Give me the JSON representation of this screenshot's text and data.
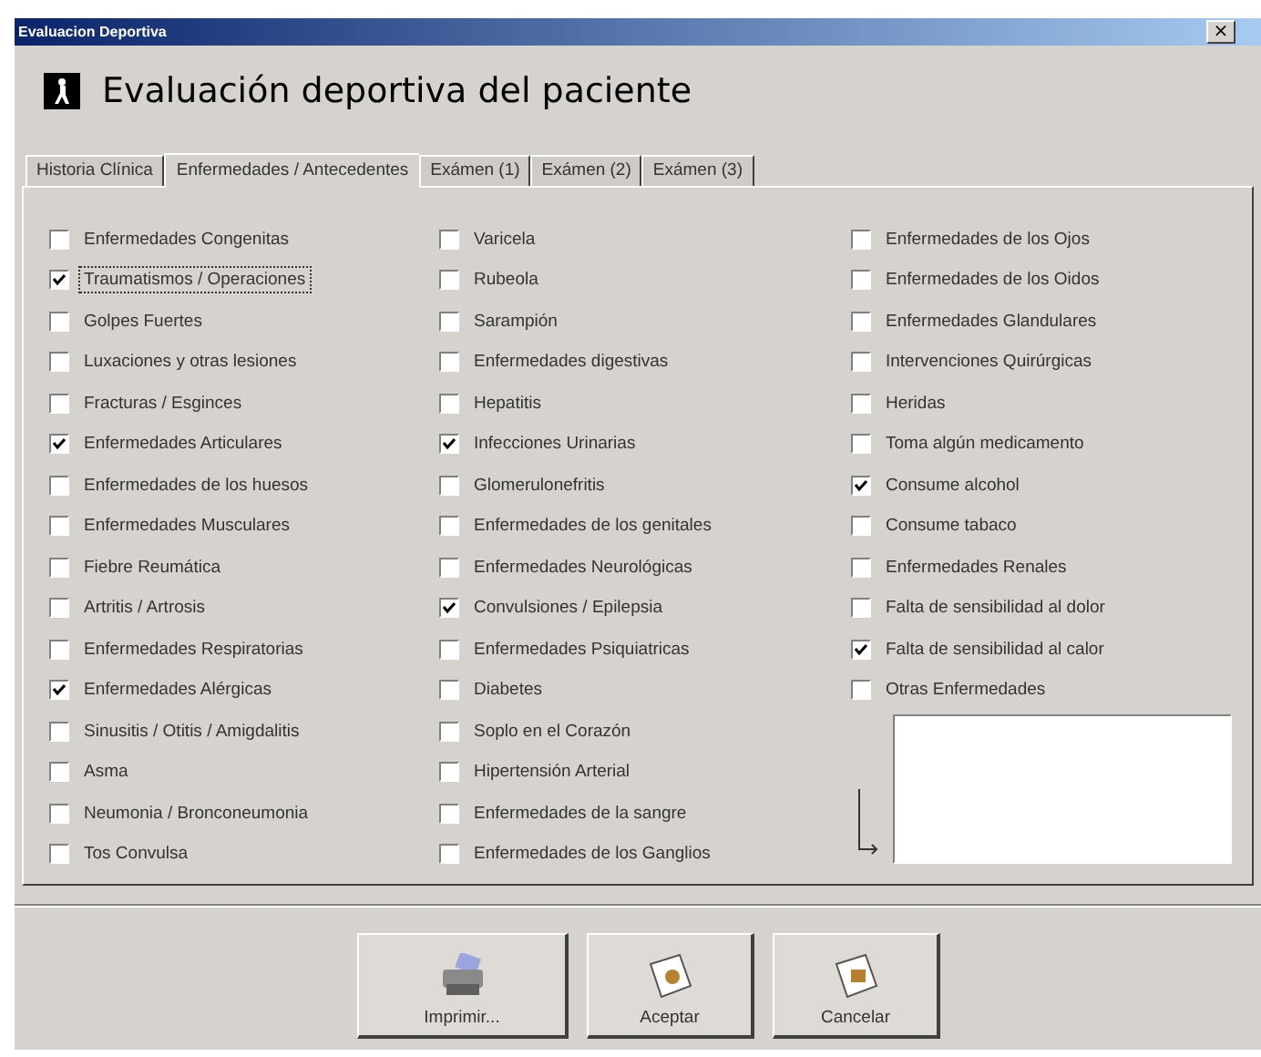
{
  "window": {
    "title": "Evaluacion Deportiva",
    "close": "×"
  },
  "header": {
    "title": "Evaluación deportiva del paciente"
  },
  "tabs": [
    {
      "label": "Historia Clínica",
      "selected": false
    },
    {
      "label": "Enfermedades / Antecedentes",
      "selected": true
    },
    {
      "label": "Exámen (1)",
      "selected": false
    },
    {
      "label": "Exámen (2)",
      "selected": false
    },
    {
      "label": "Exámen (3)",
      "selected": false
    }
  ],
  "columns": [
    {
      "items": [
        {
          "label": "Enfermedades Congenitas",
          "checked": false,
          "focused": false
        },
        {
          "label": "Traumatismos / Operaciones",
          "checked": true,
          "focused": true
        },
        {
          "label": "Golpes Fuertes",
          "checked": false,
          "focused": false
        },
        {
          "label": "Luxaciones y otras lesiones",
          "checked": false,
          "focused": false
        },
        {
          "label": "Fracturas / Esginces",
          "checked": false,
          "focused": false
        },
        {
          "label": "Enfermedades Articulares",
          "checked": true,
          "focused": false
        },
        {
          "label": "Enfermedades de los huesos",
          "checked": false,
          "focused": false
        },
        {
          "label": "Enfermedades Musculares",
          "checked": false,
          "focused": false
        },
        {
          "label": "Fiebre Reumática",
          "checked": false,
          "focused": false
        },
        {
          "label": "Artritis / Artrosis",
          "checked": false,
          "focused": false
        },
        {
          "label": "Enfermedades Respiratorias",
          "checked": false,
          "focused": false
        },
        {
          "label": "Enfermedades Alérgicas",
          "checked": true,
          "focused": false
        },
        {
          "label": "Sinusitis / Otitis / Amigdalitis",
          "checked": false,
          "focused": false
        },
        {
          "label": "Asma",
          "checked": false,
          "focused": false
        },
        {
          "label": "Neumonia / Bronconeumonia",
          "checked": false,
          "focused": false
        },
        {
          "label": "Tos Convulsa",
          "checked": false,
          "focused": false
        }
      ]
    },
    {
      "items": [
        {
          "label": "Varicela",
          "checked": false,
          "focused": false
        },
        {
          "label": "Rubeola",
          "checked": false,
          "focused": false
        },
        {
          "label": "Sarampión",
          "checked": false,
          "focused": false
        },
        {
          "label": "Enfermedades digestivas",
          "checked": false,
          "focused": false
        },
        {
          "label": "Hepatitis",
          "checked": false,
          "focused": false
        },
        {
          "label": "Infecciones Urinarias",
          "checked": true,
          "focused": false
        },
        {
          "label": "Glomerulonefritis",
          "checked": false,
          "focused": false
        },
        {
          "label": "Enfermedades de los genitales",
          "checked": false,
          "focused": false
        },
        {
          "label": "Enfermedades Neurológicas",
          "checked": false,
          "focused": false
        },
        {
          "label": "Convulsiones / Epilepsia",
          "checked": true,
          "focused": false
        },
        {
          "label": "Enfermedades Psiquiatricas",
          "checked": false,
          "focused": false
        },
        {
          "label": "Diabetes",
          "checked": false,
          "focused": false
        },
        {
          "label": "Soplo en el Corazón",
          "checked": false,
          "focused": false
        },
        {
          "label": "Hipertensión Arterial",
          "checked": false,
          "focused": false
        },
        {
          "label": "Enfermedades de la sangre",
          "checked": false,
          "focused": false
        },
        {
          "label": "Enfermedades de los Ganglios",
          "checked": false,
          "focused": false
        }
      ]
    },
    {
      "items": [
        {
          "label": "Enfermedades de los Ojos",
          "checked": false,
          "focused": false
        },
        {
          "label": "Enfermedades de los Oidos",
          "checked": false,
          "focused": false
        },
        {
          "label": "Enfermedades Glandulares",
          "checked": false,
          "focused": false
        },
        {
          "label": "Intervenciones Quirúrgicas",
          "checked": false,
          "focused": false
        },
        {
          "label": "Heridas",
          "checked": false,
          "focused": false
        },
        {
          "label": "Toma algún medicamento",
          "checked": false,
          "focused": false
        },
        {
          "label": "Consume alcohol",
          "checked": true,
          "focused": false
        },
        {
          "label": "Consume tabaco",
          "checked": false,
          "focused": false
        },
        {
          "label": "Enfermedades Renales",
          "checked": false,
          "focused": false
        },
        {
          "label": "Falta de sensibilidad al dolor",
          "checked": false,
          "focused": false
        },
        {
          "label": "Falta de sensibilidad al calor",
          "checked": true,
          "focused": false
        },
        {
          "label": "Otras Enfermedades",
          "checked": false,
          "focused": false
        }
      ],
      "other_field": {
        "kind": "textarea"
      }
    }
  ],
  "buttons": [
    {
      "label": "Imprimir...",
      "kind": "print"
    },
    {
      "label": "Aceptar",
      "kind": "accept"
    },
    {
      "label": "Cancelar",
      "kind": "cancel"
    }
  ]
}
